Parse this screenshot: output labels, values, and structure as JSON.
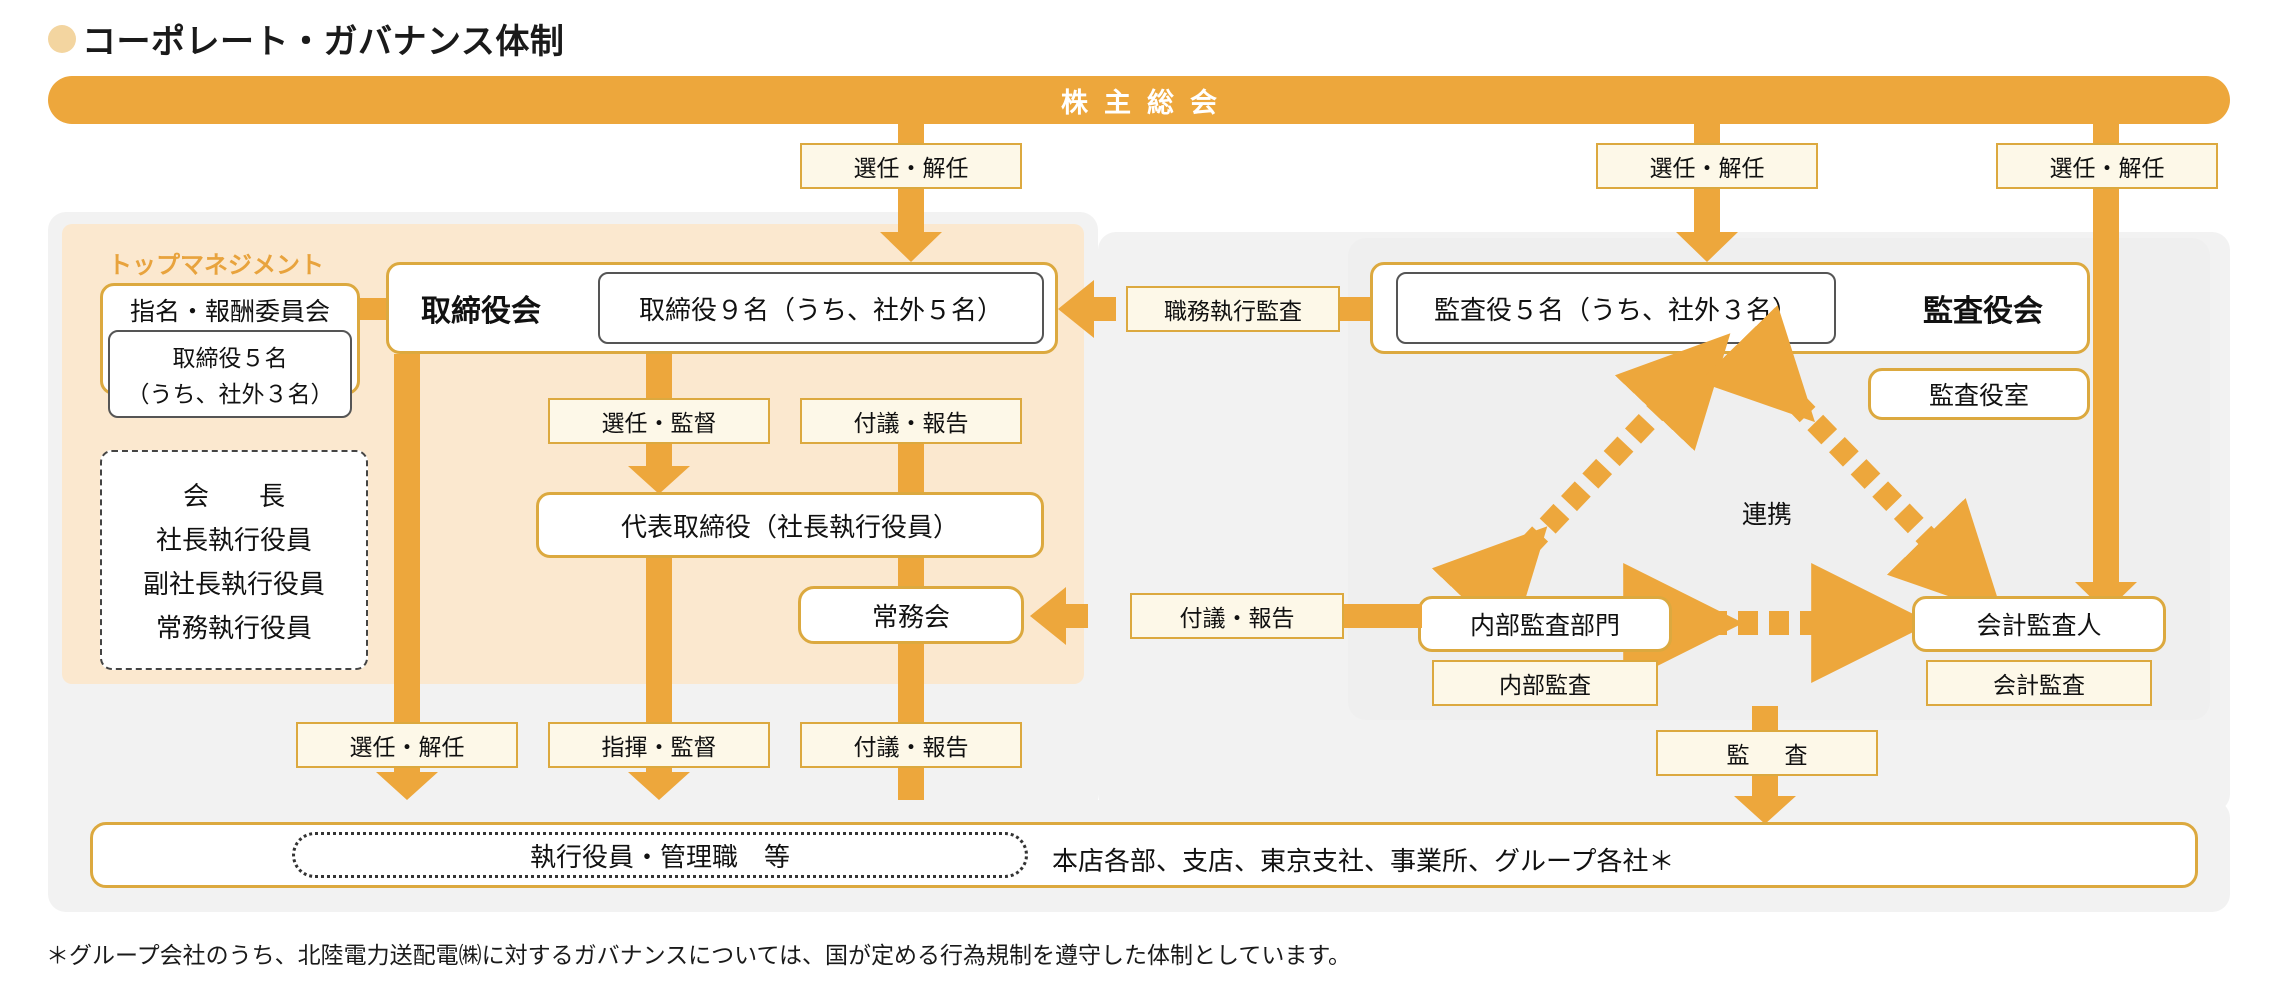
{
  "page": {
    "title": "コーポレート・ガバナンス体制",
    "bullet_color": "#f3d5a0",
    "accent_color": "#eda73c",
    "chip_fill": "#fdf8e8",
    "chip_border": "#dca93f",
    "panel_grey": "#f2f2f2",
    "panel_cream": "#fbe8cf"
  },
  "shareholders_bar": {
    "label": "株主総会"
  },
  "top_labels": {
    "center": "選任・解任",
    "audit": "選任・解任",
    "accounting": "選任・解任"
  },
  "top_management": {
    "section_label": "トップマネジメント",
    "nomination_committee": {
      "title": "指名・報酬委員会",
      "detail_line1": "取締役５名",
      "detail_line2": "（うち、社外３名）"
    },
    "officers_box": {
      "line1": "会　長",
      "line2": "社長執行役員",
      "line3": "副社長執行役員",
      "line4": "常務執行役員"
    }
  },
  "board": {
    "title": "取締役会",
    "members": "取締役９名（うち、社外５名）"
  },
  "center_labels": {
    "appoint_supervise": "選任・監督",
    "submit_report_upper": "付議・報告",
    "submit_report_lower": "付議・報告"
  },
  "representative_director": {
    "label": "代表取締役（社長執行役員）"
  },
  "executive_committee": {
    "label": "常務会"
  },
  "bottom_labels": {
    "appoint_dismiss": "選任・解任",
    "command_supervise": "指揮・監督",
    "submit_report": "付議・報告"
  },
  "audit_section": {
    "duty_execution_audit": "職務執行監査",
    "auditors_box": "監査役５名（うち、社外３名）",
    "board_of_auditors": "監査役会",
    "auditors_office": "監査役室",
    "cooperation": "連携",
    "internal_audit_dept": "内部監査部門",
    "internal_audit_label": "内部監査",
    "accounting_auditor": "会計監査人",
    "accounting_audit_label": "会計監査",
    "submit_report_to_committee": "付議・報告",
    "audit_label": "監　査"
  },
  "bottom_bar": {
    "executives_box": "執行役員・管理職　等",
    "organizations": "本店各部、支店、東京支社、事業所、グループ各社＊"
  },
  "footnote": {
    "text": "＊グループ会社のうち、北陸電力送配電㈱に対するガバナンスについては、国が定める行為規制を遵守した体制としています。"
  }
}
